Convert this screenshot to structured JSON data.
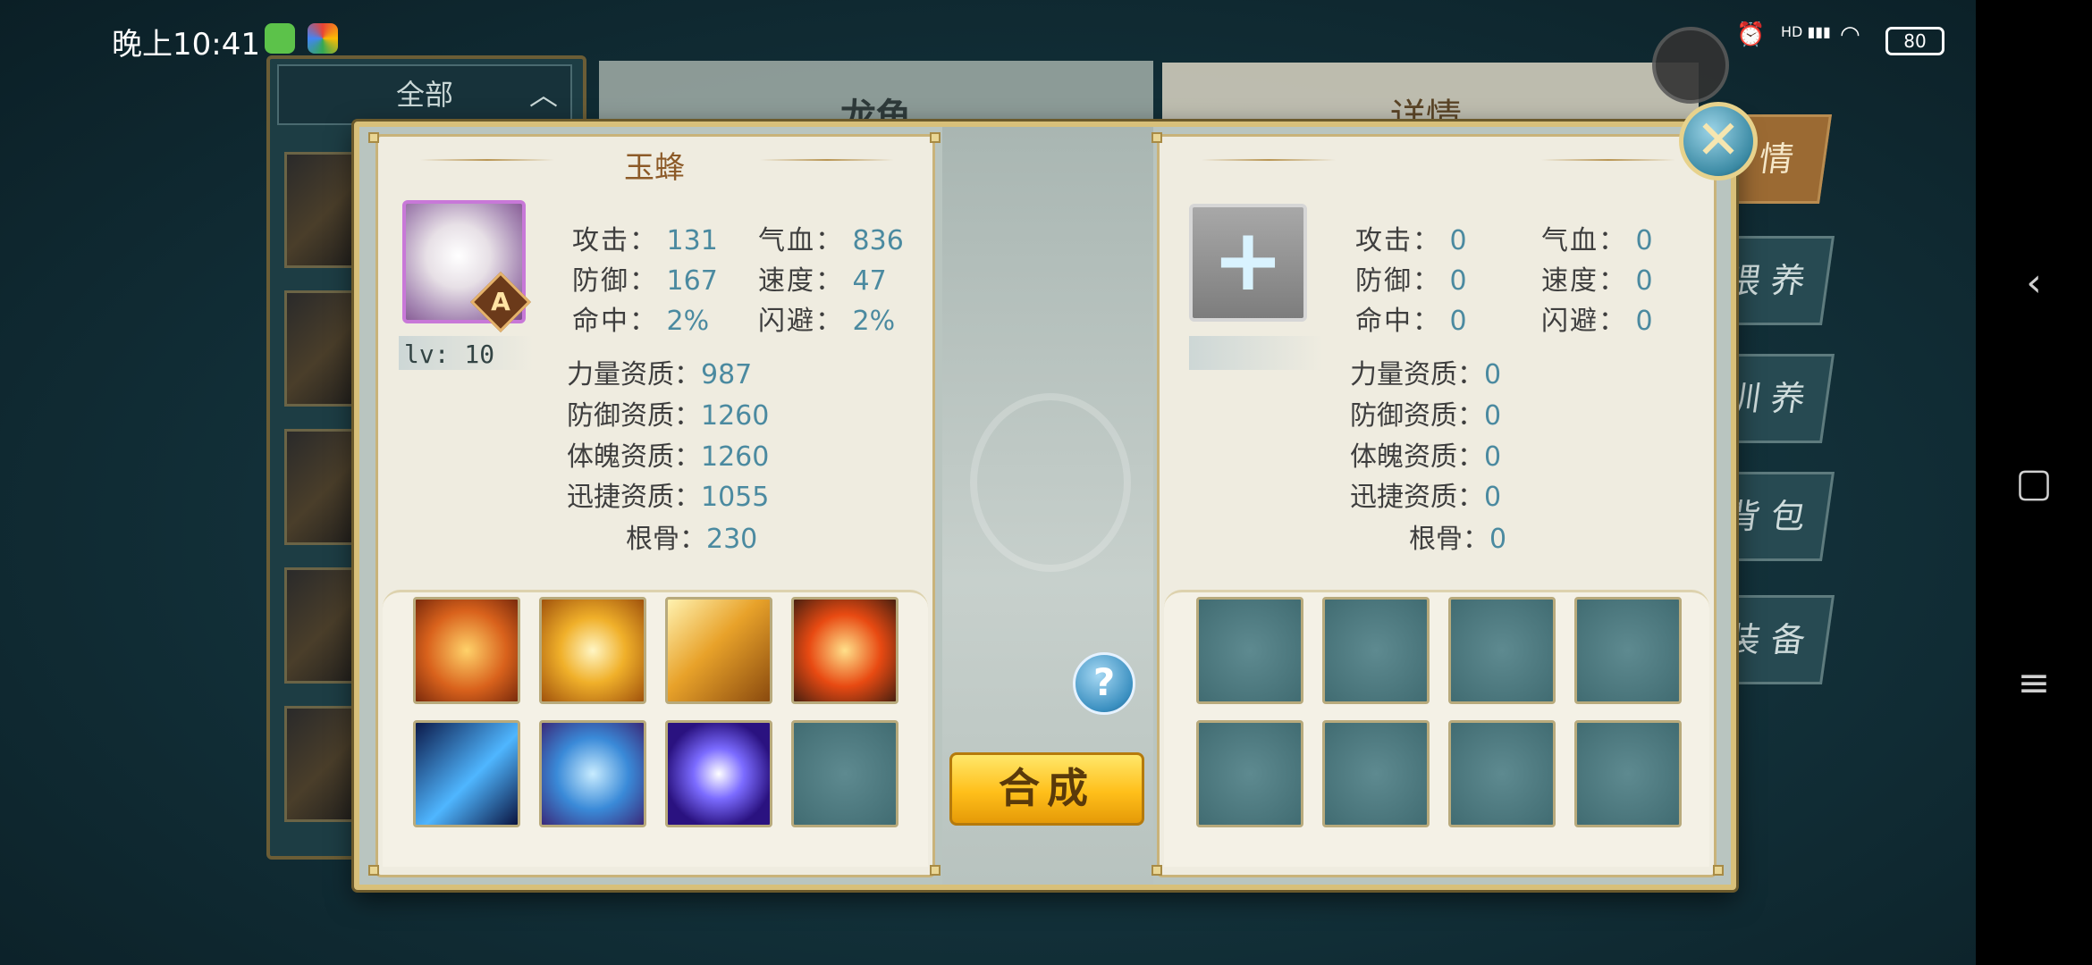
{
  "status_bar": {
    "time": "晚上10:41",
    "hd_label": "HD",
    "battery": "80"
  },
  "background": {
    "filter_label": "全部",
    "center_title": "龙龟",
    "right_title": "详情",
    "tabs": [
      "情",
      "喂 养",
      "训 养",
      "背 包",
      "装 备"
    ]
  },
  "left_pet": {
    "name": "玉蜂",
    "grade": "A",
    "level": "lv: 10",
    "stats": [
      {
        "label": "攻击：",
        "value": "131"
      },
      {
        "label": "气血：",
        "value": "836"
      },
      {
        "label": "防御：",
        "value": "167"
      },
      {
        "label": "速度：",
        "value": "47"
      },
      {
        "label": "命中：",
        "value": "2%"
      },
      {
        "label": "闪避：",
        "value": "2%"
      }
    ],
    "aptitudes": [
      {
        "label": "力量资质：",
        "value": "987"
      },
      {
        "label": "防御资质：",
        "value": "1260"
      },
      {
        "label": "体魄资质：",
        "value": "1260"
      },
      {
        "label": "迅捷资质：",
        "value": "1055"
      },
      {
        "label": "根骨：",
        "value": "230"
      }
    ],
    "skills": [
      "shield-skill-icon",
      "light-burst-skill-icon",
      "golden-spear-skill-icon",
      "flame-orb-skill-icon",
      "ice-claw-skill-icon",
      "blue-shield-skill-icon",
      "void-orb-skill-icon",
      "empty-skill-slot"
    ]
  },
  "right_pet": {
    "add_icon": "+",
    "stats": [
      {
        "label": "攻击：",
        "value": "0"
      },
      {
        "label": "气血：",
        "value": "0"
      },
      {
        "label": "防御：",
        "value": "0"
      },
      {
        "label": "速度：",
        "value": "0"
      },
      {
        "label": "命中：",
        "value": "0"
      },
      {
        "label": "闪避：",
        "value": "0"
      }
    ],
    "aptitudes": [
      {
        "label": "力量资质：",
        "value": "0"
      },
      {
        "label": "防御资质：",
        "value": "0"
      },
      {
        "label": "体魄资质：",
        "value": "0"
      },
      {
        "label": "迅捷资质：",
        "value": "0"
      },
      {
        "label": "根骨：",
        "value": "0"
      }
    ]
  },
  "actions": {
    "help": "?",
    "merge": "合成",
    "close": "✕"
  },
  "colors": {
    "stat_value": "#4b8aa0",
    "title": "#8c5a28",
    "merge_button": "#ffbf1a"
  }
}
